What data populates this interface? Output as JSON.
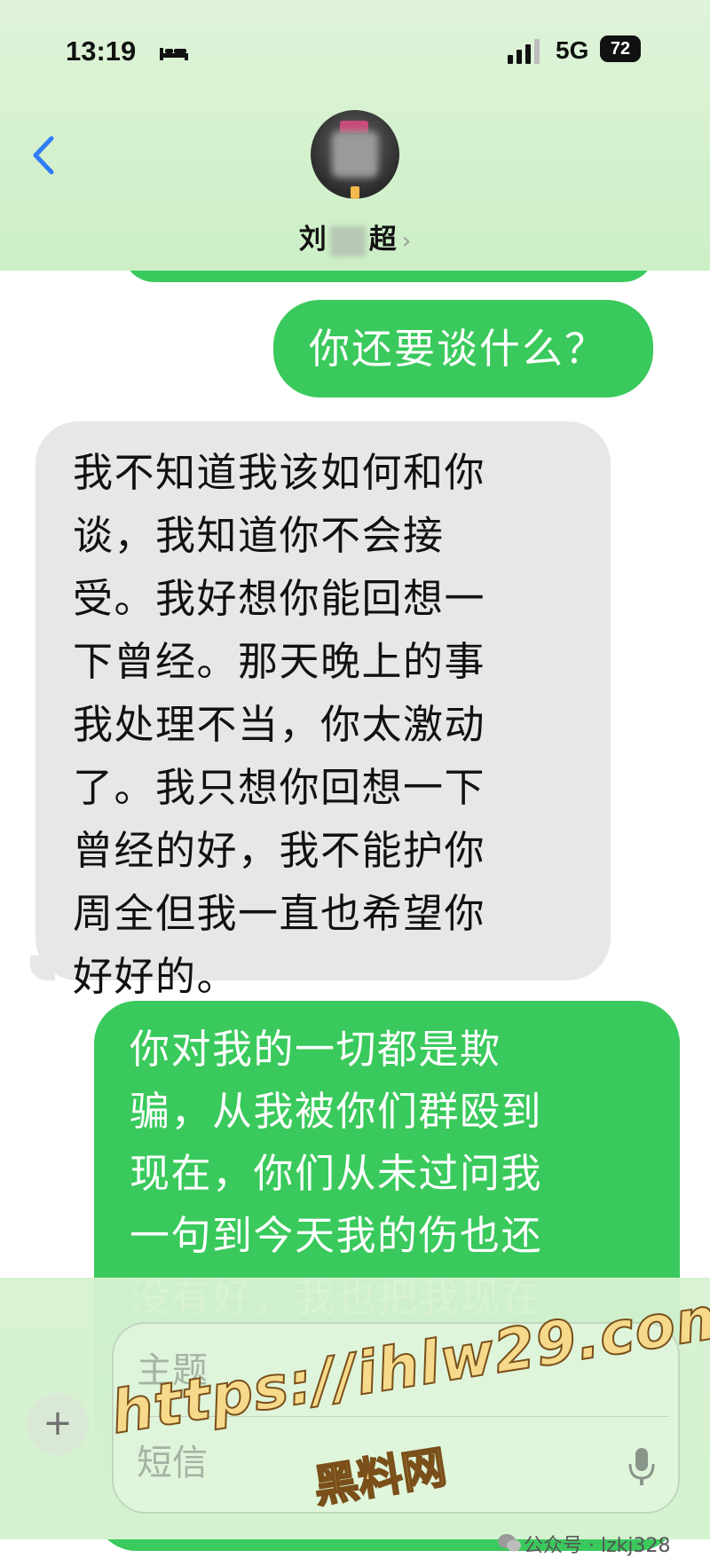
{
  "status_bar": {
    "time": "13:19",
    "network": "5G",
    "battery": "72"
  },
  "header": {
    "contact_name_start": "刘",
    "contact_name_end": "超",
    "chevron": "›"
  },
  "messages": [
    {
      "side": "outgoing",
      "text": "你还要谈什么？"
    },
    {
      "side": "incoming",
      "lines": [
        "我不知道我该如何和你",
        "谈，我知道你不会接",
        "受。我好想你能回想一",
        "下曾经。那天晚上的事",
        "我处理不当，你太激动",
        "了。我只想你回想一下",
        "曾经的好，我不能护你",
        "周全但我一直也希望你",
        "好好的。"
      ]
    },
    {
      "side": "outgoing",
      "lines": [
        "你对我的一切都是欺",
        "骗，从我被你们群殴到",
        "现在，你们从未过问我",
        "一句到今天我的伤也还",
        "没有好，我也把我现在"
      ]
    }
  ],
  "compose": {
    "plus": "+",
    "subject_placeholder": "主题",
    "message_placeholder": "短信"
  },
  "watermark": {
    "url": "https://ihlw29.com",
    "name": "黑料网"
  },
  "attribution": {
    "text": "公众号 · lzkj328"
  },
  "colors": {
    "outgoing_bubble": "#3ac95c",
    "incoming_bubble": "#e7e7ea",
    "accent": "#2f7cf6"
  }
}
